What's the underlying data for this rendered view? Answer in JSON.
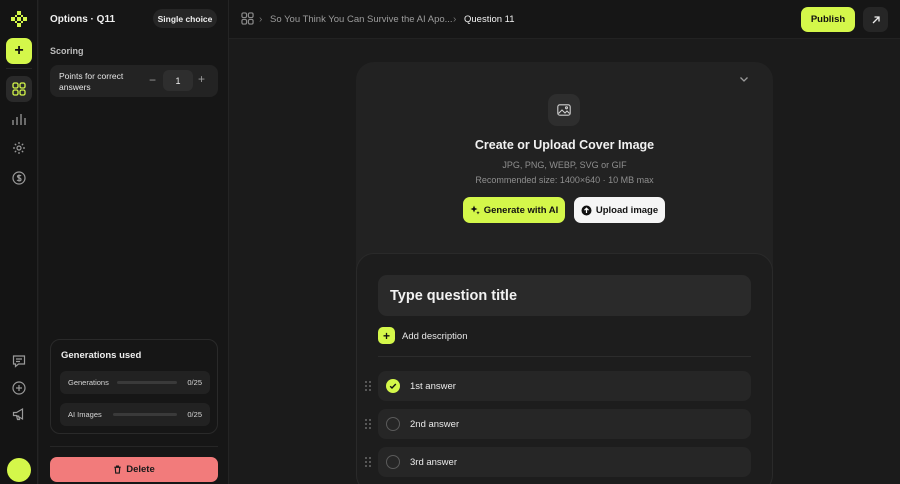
{
  "colors": {
    "accent": "#d4f74a",
    "danger": "#f27b7b",
    "background": "#1b1b1b"
  },
  "rail": {
    "icons": [
      "logo-icon",
      "add-icon",
      "grid-icon",
      "chart-icon",
      "gear-icon",
      "dollar-icon",
      "chat-icon",
      "plus-circle-icon",
      "megaphone-icon"
    ]
  },
  "panel": {
    "title": "Options · Q11",
    "type_chip": "Single choice",
    "scoring_label": "Scoring",
    "points_label": "Points for correct answers",
    "points_minus": "−",
    "points_value": "1",
    "points_plus": "+",
    "generations": {
      "title": "Generations used",
      "rows": [
        {
          "label": "Generations",
          "count": "0/25",
          "used_fraction": 0
        },
        {
          "label": "AI Images",
          "count": "0/25",
          "used_fraction": 0
        }
      ]
    },
    "delete_label": "Delete"
  },
  "topbar": {
    "breadcrumb": [
      "So You Think You Can Survive the AI Apo...",
      "Question 11"
    ],
    "publish_label": "Publish"
  },
  "cover": {
    "title": "Create or Upload Cover Image",
    "formats": "JPG, PNG, WEBP, SVG or GIF",
    "recommended": "Recommended size: 1400×640 · 10 MB max",
    "generate_label": "Generate with AI",
    "upload_label": "Upload image"
  },
  "question": {
    "title_placeholder": "Type question title",
    "add_description": "Add description",
    "answers": [
      {
        "label": "1st answer",
        "correct": true
      },
      {
        "label": "2nd answer",
        "correct": false
      },
      {
        "label": "3rd answer",
        "correct": false
      }
    ]
  }
}
